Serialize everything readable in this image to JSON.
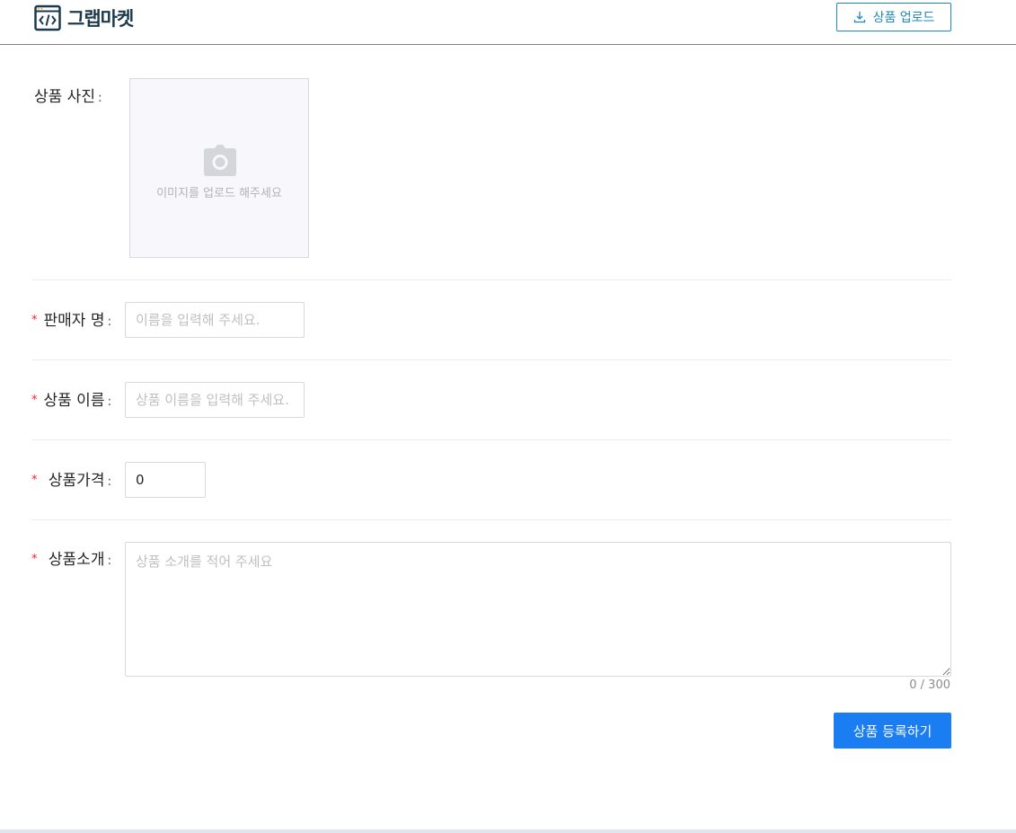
{
  "header": {
    "logo_text": "그랩마켓",
    "upload_button_label": "상품 업로드"
  },
  "form": {
    "photo": {
      "label": "상품 사진",
      "hint": "이미지를 업로드 해주세요"
    },
    "seller": {
      "label": "판매자 명",
      "placeholder": "이름을 입력해 주세요."
    },
    "name": {
      "label": "상품 이름",
      "placeholder": "상품 이름을 입력해 주세요."
    },
    "price": {
      "label": "상품가격",
      "value": "0"
    },
    "description": {
      "label": "상품소개",
      "placeholder": "상품 소개를 적어 주세요",
      "counter": "0 / 300"
    },
    "required_mark": "*",
    "colon": ":",
    "submit_label": "상품 등록하기"
  },
  "colors": {
    "accent": "#1a7ef2",
    "outline_button": "#1e8ab8",
    "required": "#f5222d"
  }
}
